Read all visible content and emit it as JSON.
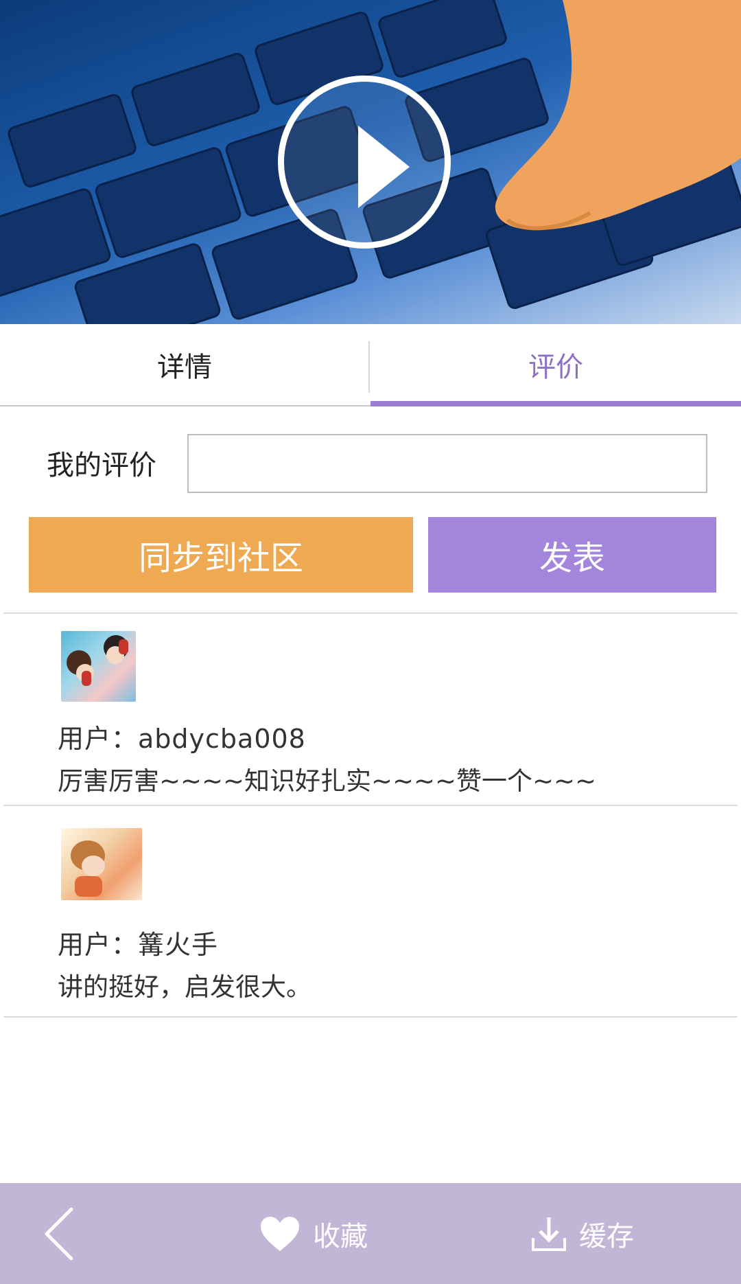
{
  "tabs": {
    "details": "详情",
    "reviews": "评价"
  },
  "review_form": {
    "label": "我的评价",
    "input_value": "",
    "input_placeholder": "",
    "sync_label": "同步到社区",
    "publish_label": "发表"
  },
  "comments": [
    {
      "user": "用户：abdycba008",
      "text": "厉害厉害~~~~知识好扎实~~~~赞一个~~~"
    },
    {
      "user": "用户：篝火手",
      "text": "讲的挺好，启发很大。"
    }
  ],
  "bottom_bar": {
    "favorite_label": "收藏",
    "cache_label": "缓存"
  },
  "colors": {
    "accent_purple": "#9b7ed4",
    "sync_orange": "#eea952",
    "publish_purple": "#a386dc",
    "bottom_bar": "#c2b6d6"
  },
  "icons": {
    "play": "play-icon",
    "back": "chevron-left-icon",
    "favorite": "heart-icon",
    "cache": "download-icon"
  }
}
